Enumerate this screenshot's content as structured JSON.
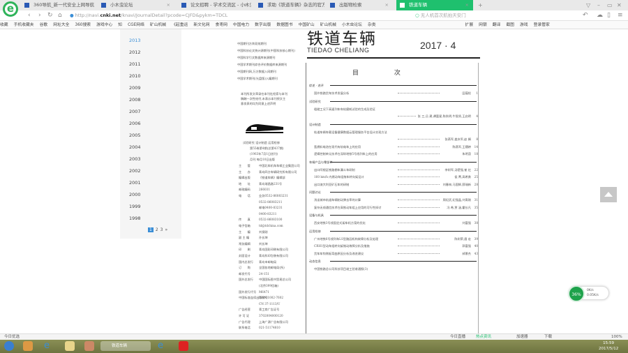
{
  "browser": {
    "tabs": [
      {
        "label": "360导航_新一代安全上网导航",
        "active": false
      },
      {
        "label": "小木虫论坛",
        "active": false
      },
      {
        "label": "论文招聘 - 学术交流区 - 小木虫",
        "active": false
      },
      {
        "label": "求助《铁道车辆》杂志的官方网站",
        "active": false
      },
      {
        "label": "出版物检索",
        "active": false
      },
      {
        "label": "铁道车辆",
        "active": true
      }
    ],
    "new_tab": "+",
    "url_prefix": "http://navi.",
    "url_domain": "cnki.net",
    "url_path": "/knavi/JournalDetail?pcode=CJFD&pykm=TDCL",
    "search_placeholder": "无人机首次航拍天安门",
    "bookmarks": [
      "收藏",
      "手机收藏夹",
      "谷歌",
      "网址大全",
      "360搜索",
      "游戏中心",
      "知",
      "CGE网络",
      "矿山机械",
      "《起重运",
      "新文化网",
      "食枣网",
      "中国电力",
      "数字出版",
      "数据图书",
      "中国矿山",
      "矿山机械",
      "小木虫论坛",
      "杂类",
      "扩展",
      "网银",
      "翻译",
      "截图",
      "游戏",
      "登录管家"
    ]
  },
  "years": [
    "2013",
    "2012",
    "2011",
    "2010",
    "2009",
    "2008",
    "2007",
    "2006",
    "2005",
    "2004",
    "2003",
    "2002",
    "2001",
    "2000",
    "1999",
    "1998"
  ],
  "pager": [
    "1",
    "2",
    "3",
    "»"
  ],
  "doc": {
    "title": "铁道车辆",
    "pinyin": "TIEDAO   CHELIANG",
    "issue": "2017 · 4",
    "toc_heading": "目 次",
    "badges": [
      "中国期刊方阵双效期刊",
      "中国科技论文统计源期刊(中国科技核心期刊)",
      "中国科学引文数据库来源期刊",
      "中国学术期刊综合评价数据库来源期刊",
      "中国期刊网,万方数据入网期刊",
      "中国学术期刊(光盘版)入编期刊"
    ],
    "notice": [
      "本刊所发文章录在本刊社检索与本刊",
      "稿酬一次性给付,未表示本刊授文主",
      "意发表的均为同意上述声明"
    ],
    "masthead": [
      "试验研究  设计制造  运用检修",
      "第55卷第4期(总第437期)",
      "(1963年7月1日创刊)",
      "月刊  每月10日出版"
    ],
    "info": [
      [
        "主　　管",
        "中国北车机车车辆工业集团公司"
      ],
      [
        "主　　办",
        "青岛四方车辆研究所有限公司"
      ],
      [
        "编辑出版",
        "《铁道车辆》编辑部"
      ],
      [
        "地　　址",
        "青岛瑞昌路231号"
      ],
      [
        "邮政编码",
        "266031"
      ],
      [
        "电　　话",
        "业务0532-86083231"
      ],
      [
        "",
        "0532-86083211"
      ],
      [
        "",
        "邮电0400-83231"
      ],
      [
        "",
        "0400-83211"
      ],
      [
        "传　　真",
        "0532-86083100"
      ],
      [
        "电子信箱",
        "td@tdchina.com"
      ],
      [
        "主　　编",
        "刘保刚"
      ],
      [
        "副 主 编",
        "孙长坤"
      ],
      [
        "常务编辑",
        "刘长坤"
      ],
      [
        "印　　刷",
        "青岛国彩印刷有限公司"
      ],
      [
        "封面设计",
        "青岛科印包装有限公司"
      ],
      [
        "国内总发行",
        "青岛市邮电局"
      ],
      [
        "订　　购",
        "全国各地邮电局(所)"
      ],
      [
        "邮发代号",
        "24-151"
      ],
      [
        "国外总发行",
        "中国国际图书贸易总公司"
      ],
      [
        "",
        "(北京399信箱)"
      ],
      [
        "国外发行代号",
        "M6471"
      ],
      [
        "中国标准连续出版物号",
        "ISSN 1002-7602"
      ],
      [
        "",
        "CN 37-1113/U"
      ],
      [
        "广告经营",
        "青工商广告证号"
      ],
      [
        "许 可 证",
        "3702004000120"
      ],
      [
        "广告代理",
        "上海广源广告有限公司"
      ],
      [
        "联系电话",
        "021-51174810"
      ]
    ],
    "toc": [
      {
        "section": "综述 · 述评",
        "entries": [
          {
            "t": "国外铁路货车技术发展分析",
            "a": "田葆栓",
            "p": "1"
          }
        ]
      },
      {
        "section": "试验研究",
        "entries": [
          {
            "t": "粗糙工况下高速列车车轮磨耗试验的生成及验证",
            "a": "",
            "p": ""
          },
          {
            "t": "",
            "a": "张 三,吕 建,谭富星,陈秋明,牛智贤,王启明",
            "p": "4"
          }
        ]
      },
      {
        "section": "设计制造",
        "entries": [
          {
            "t": "轨道车辆车载设备健康数据云管理服务平台设计实现方法",
            "a": "",
            "p": ""
          },
          {
            "t": "",
            "a": "张燕军,姜庆军,赵 娟",
            "p": "8"
          },
          {
            "t": "氢燃料电池在现代有轨电车上的应用",
            "a": "陈燕军,王穗婷",
            "p": "14"
          },
          {
            "t": "逻辑控制单元技术在深圳地铁5号线列车上的应用",
            "a": "朱明茂",
            "p": "18"
          }
        ]
      },
      {
        "section": "车辆产品与零部件",
        "entries": [
          {
            "t": "出口阿根廷铁路棚车漏斗车研制",
            "a": "李树军,汤楚强,崔 红",
            "p": "22"
          },
          {
            "t": "160 km/h 内燃动车组拖车转向架设计",
            "a": "侯 菁,高希勇",
            "p": "25"
          },
          {
            "t": "出口澳大利亚矿石车的研制",
            "a": "刘春林,马国辉,薛瑞新",
            "p": "28"
          }
        ]
      },
      {
        "section": "问题讨论",
        "entries": [
          {
            "t": "浅谈城市轨道车辆制动弹去率的计算",
            "a": "周纪武,纪强晶,刘青刚",
            "p": "31"
          },
          {
            "t": "复杂无线通信技术在高铁动车组上应用的可行性探讨",
            "a": "冯 希,贾 涵,霍长凡",
            "p": "35"
          }
        ]
      },
      {
        "section": "设备与机具",
        "entries": [
          {
            "t": "西安地铁3号线固定式架车机方案的优化",
            "a": "刘富强",
            "p": "38"
          }
        ]
      },
      {
        "section": "运用检修",
        "entries": [
          {
            "t": "广州地铁6号线列车LS型路因机构故障分析及处理",
            "a": "陈树荣,唐 宏",
            "p": "39"
          },
          {
            "t": "CRH1型动车组转向架制动故障分析及措施",
            "a": "郭富强",
            "p": "40"
          },
          {
            "t": "货车车钩侧板弯曲原因分析及改进建议",
            "a": "郝景杰",
            "p": "43"
          }
        ]
      },
      {
        "section": "动态信息",
        "entries": [
          {
            "t": "中国铁路总公司科技项目竣工验收通报(3)",
            "a": "",
            "p": ""
          }
        ]
      }
    ]
  },
  "speed": {
    "percent": "36%",
    "up": "0K/s",
    "down": "0.05K/s"
  },
  "status": {
    "news": "今日优选",
    "today": "今日直播",
    "hot": "热点资讯",
    "accelerator": "加速器",
    "download": "下载",
    "zoom": "100%"
  },
  "clock": {
    "time": "15:59",
    "date": "2017/5/12"
  }
}
